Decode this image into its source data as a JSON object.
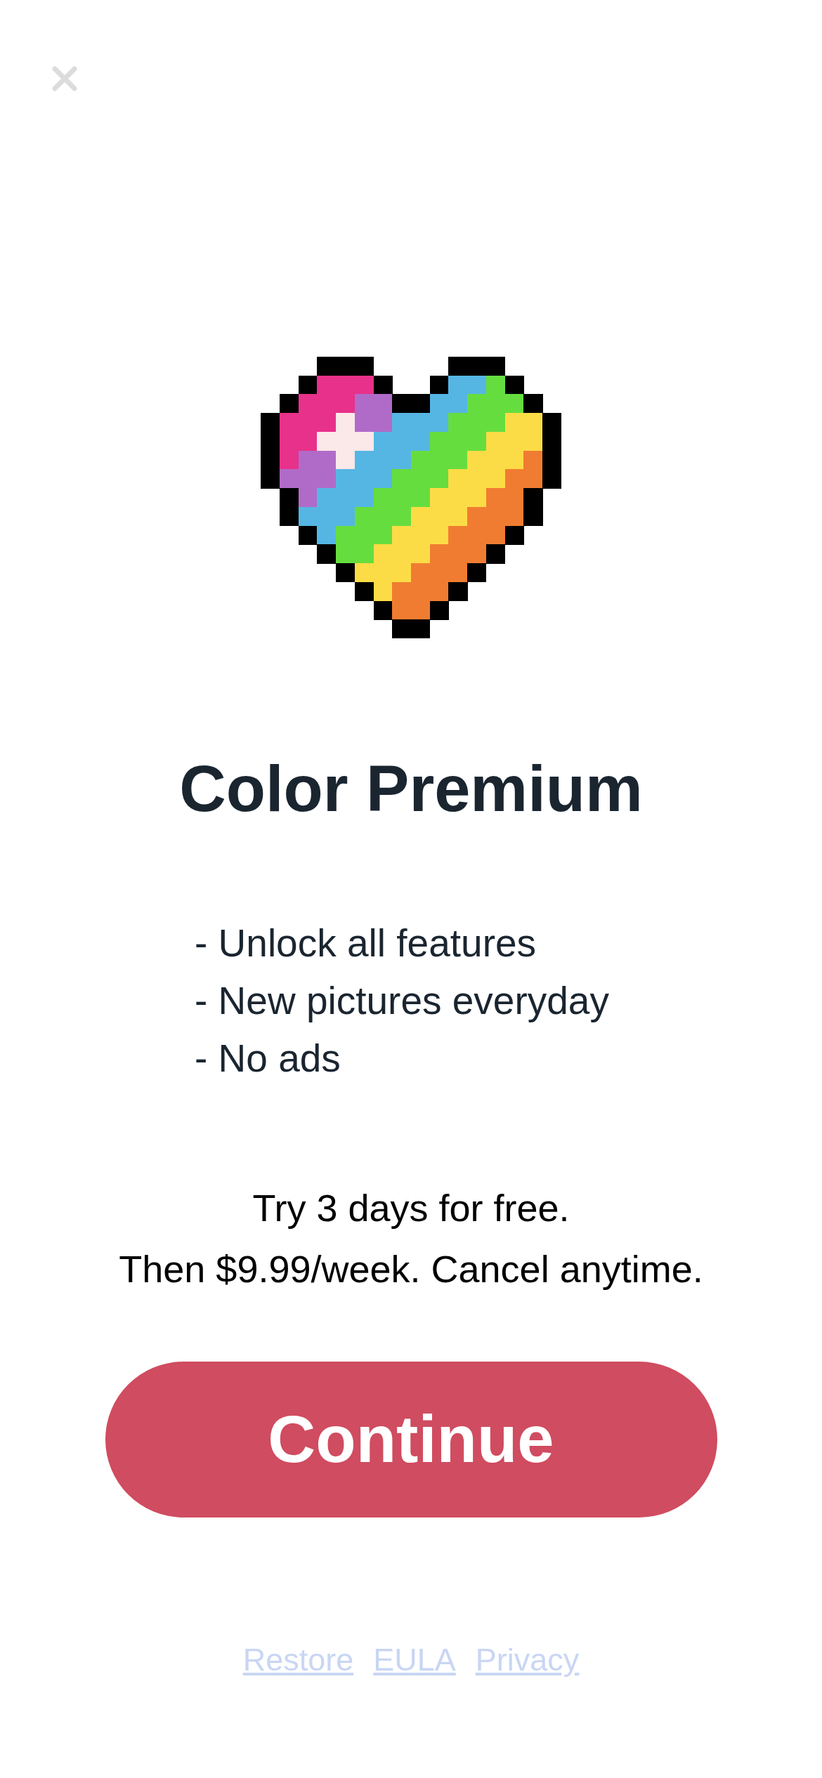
{
  "title": "Color Premium",
  "features": [
    "- Unlock all features",
    "- New pictures everyday",
    "- No ads"
  ],
  "offer_lines": [
    "Try 3 days for free.",
    "Then $9.99/week. Cancel anytime."
  ],
  "continue_button": "Continue",
  "footer_links": [
    "Restore",
    "EULA",
    "Privacy"
  ]
}
